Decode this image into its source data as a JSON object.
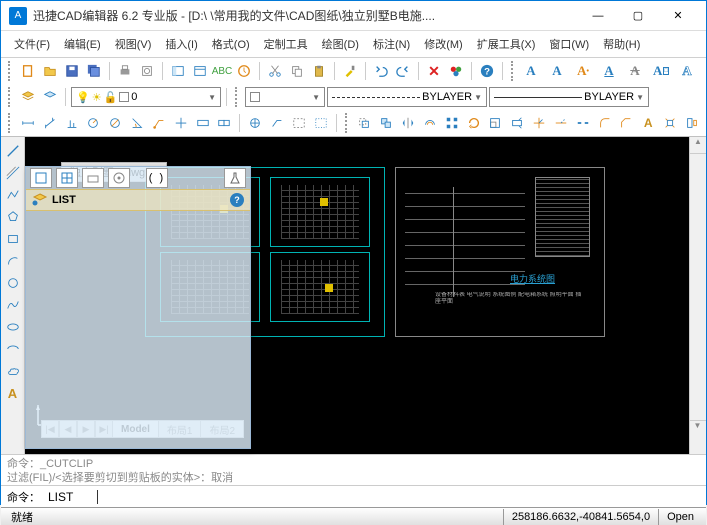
{
  "window": {
    "logo_letter": "A",
    "title": "迅捷CAD编辑器 6.2 专业版 - [D:\\                               \\常用我的文件\\CAD图纸\\独立别墅B电施....",
    "controls": {
      "min": "—",
      "max": "▢",
      "close": "✕"
    }
  },
  "menu": [
    "文件(F)",
    "编辑(E)",
    "视图(V)",
    "插入(I)",
    "格式(O)",
    "定制工具",
    "绘图(D)",
    "标注(N)",
    "修改(M)",
    "扩展工具(X)",
    "窗口(W)",
    "帮助(H)"
  ],
  "document_tab": {
    "name": "独立别墅B电施...dwg",
    "close": "×"
  },
  "layer_panel": {
    "combo1": "0",
    "combo2": "BYLAYER",
    "combo3": "BYLAYER"
  },
  "float_panel": {
    "list_label": "LIST",
    "bracket_btn": "( )"
  },
  "model_tabs": {
    "nav": [
      "|◀",
      "◀",
      "▶",
      "▶|"
    ],
    "tabs": [
      "Model",
      "布局1",
      "布局2"
    ],
    "active": 0
  },
  "command": {
    "history": [
      "命令：_CUTCLIP",
      "过滤(FIL)/<选择要剪切到剪贴板的实体>：取消",
      "取消"
    ],
    "prompt": "命令：",
    "input_value": "LIST"
  },
  "status": {
    "ready": "就绪",
    "coords": "258186.6632,-40841.5654,0",
    "open": "Open"
  },
  "chart_label": "电力系统图"
}
